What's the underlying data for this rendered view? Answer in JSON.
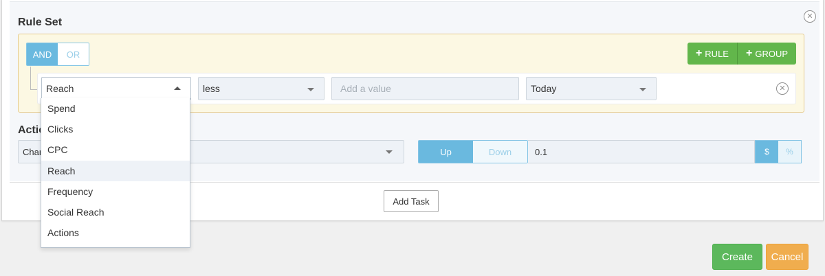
{
  "rule_set": {
    "title": "Rule Set",
    "conditions": {
      "and_label": "AND",
      "or_label": "OR",
      "active": "AND"
    },
    "add_rule_label": "RULE",
    "add_group_label": "GROUP",
    "rule": {
      "field": "Reach",
      "operator": "less",
      "value_placeholder": "Add a value",
      "period": "Today"
    },
    "field_options": [
      "Spend",
      "Clicks",
      "CPC",
      "Reach",
      "Frequency",
      "Social Reach",
      "Actions"
    ],
    "selected_option": "Reach"
  },
  "actions": {
    "title": "Actio",
    "action_select": "Char",
    "direction": {
      "up_label": "Up",
      "down_label": "Down",
      "active": "Up"
    },
    "amount": "0.1",
    "units": {
      "dollar_label": "$",
      "percent_label": "%",
      "active": "$"
    }
  },
  "add_task_label": "Add Task",
  "footer": {
    "create_label": "Create",
    "cancel_label": "Cancel"
  },
  "colors": {
    "accent_blue": "#6ab9df",
    "green": "#62b64b",
    "create_green": "#5cb85c",
    "cancel_orange": "#f0ad4e",
    "ruleset_bg": "#fcf8e3",
    "ruleset_border": "#e6ca8b"
  },
  "icons": {
    "close": "close-circle-icon",
    "plus": "plus-icon",
    "caret": "caret-down-icon"
  }
}
